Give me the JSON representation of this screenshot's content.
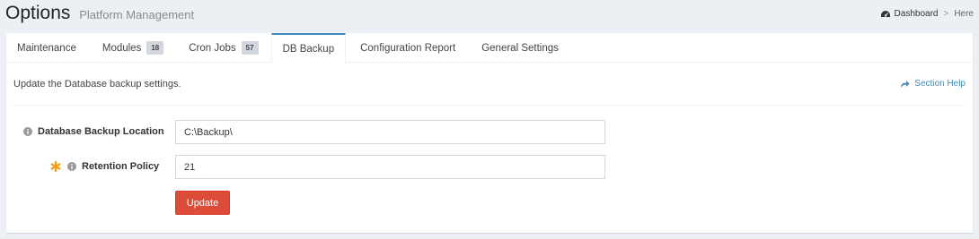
{
  "header": {
    "title": "Options",
    "subtitle": "Platform Management"
  },
  "breadcrumb": {
    "icon": "dashboard-icon",
    "items": [
      "Dashboard",
      "Here"
    ],
    "separator": ">"
  },
  "tabs": [
    {
      "label": "Maintenance"
    },
    {
      "label": "Modules",
      "badge": "18"
    },
    {
      "label": "Cron Jobs",
      "badge": "57"
    },
    {
      "label": "DB Backup",
      "active": true
    },
    {
      "label": "Configuration Report"
    },
    {
      "label": "General Settings"
    }
  ],
  "content": {
    "description": "Update the Database backup settings.",
    "section_help": "Section Help"
  },
  "form": {
    "backup_location": {
      "label": "Database Backup Location",
      "value": "C:\\Backup\\",
      "icon": "info-icon"
    },
    "retention_policy": {
      "label": "Retention Policy",
      "value": "21",
      "required": true,
      "icon": "info-icon"
    },
    "update_label": "Update"
  },
  "colors": {
    "accent": "#3c8dbc",
    "danger": "#dd4b39",
    "required": "#f39c12",
    "background": "#ecf0f5"
  }
}
